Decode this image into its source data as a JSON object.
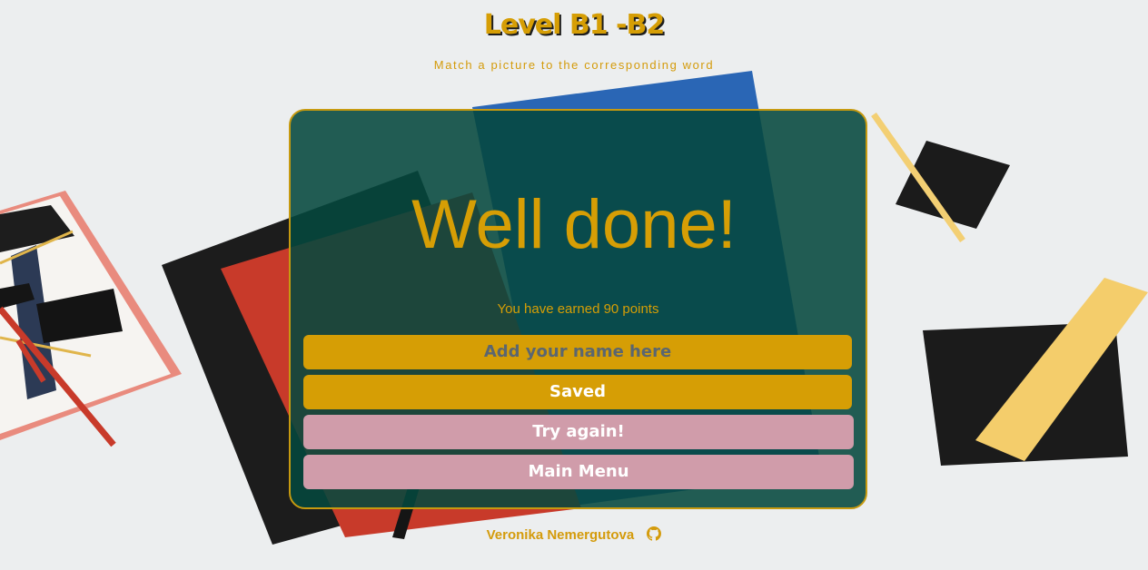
{
  "header": {
    "title": "Level B1 -B2",
    "subtitle": "Match a picture to the corresponding word"
  },
  "result": {
    "heading": "Well done!",
    "points_text": "You have earned 90 points"
  },
  "form": {
    "name_placeholder": "Add your name here",
    "saved_label": "Saved",
    "try_again_label": "Try again!",
    "main_menu_label": "Main Menu"
  },
  "footer": {
    "author": "Veronika Nemergutova",
    "icon": "github-icon"
  },
  "colors": {
    "accent": "#d69e05",
    "card_bg": "#04483e",
    "pink_button": "#d09caa",
    "page_bg": "#eceeef"
  }
}
